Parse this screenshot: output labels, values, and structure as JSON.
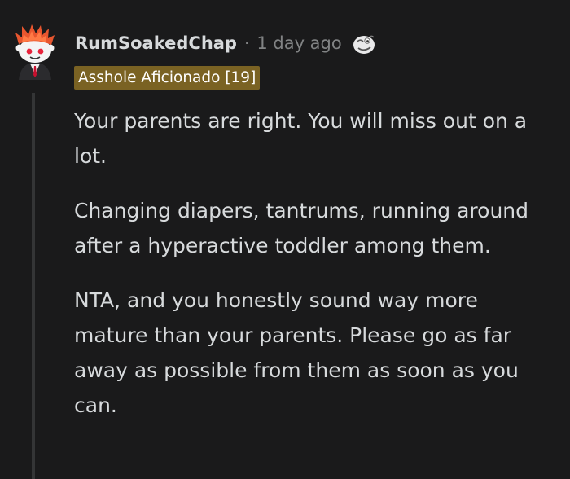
{
  "comment": {
    "author": "RumSoakedChap",
    "separator": "·",
    "timestamp": "1 day ago",
    "flair": "Asshole Aficionado [19]",
    "award_icon": "awesome-answer-award-icon",
    "avatar": "snoo-avatar-icon",
    "paragraphs": [
      "Your parents are right. You will miss out on a lot.",
      "Changing diapers, tantrums, running around after a hyperactive toddler among them.",
      "NTA, and you honestly sound way more mature than your parents. Please go as far away as possible from them as soon as you can."
    ]
  },
  "colors": {
    "background": "#1a1a1b",
    "text": "#d7dadc",
    "meta": "#818384",
    "flair_bg": "#7a6223",
    "thread_line": "#343536"
  }
}
